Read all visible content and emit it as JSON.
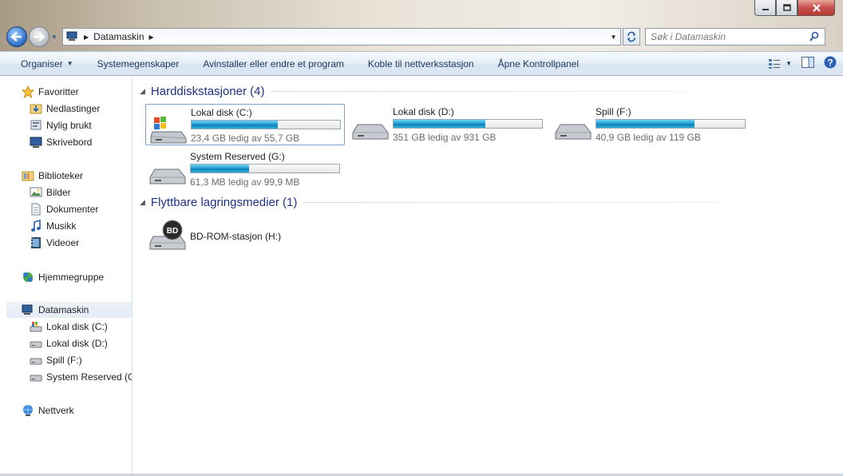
{
  "window": {
    "caption_buttons": [
      "minimize",
      "maximize",
      "close"
    ]
  },
  "address": {
    "crumbs": [
      "Datamaskin"
    ],
    "search_placeholder": "Søk i Datamaskin"
  },
  "toolbar": {
    "organize": "Organiser",
    "system_properties": "Systemegenskaper",
    "uninstall": "Avinstaller eller endre et program",
    "map_drive": "Koble til nettverksstasjon",
    "control_panel": "Åpne Kontrollpanel"
  },
  "nav": {
    "favorites": "Favoritter",
    "downloads": "Nedlastinger",
    "recent": "Nylig brukt",
    "desktop": "Skrivebord",
    "libraries": "Biblioteker",
    "pictures": "Bilder",
    "documents": "Dokumenter",
    "music": "Musikk",
    "videos": "Videoer",
    "homegroup": "Hjemmegruppe",
    "computer": "Datamaskin",
    "drive_c": "Lokal disk (C:)",
    "drive_d": "Lokal disk (D:)",
    "drive_f": "Spill (F:)",
    "drive_g": "System Reserved (G:)",
    "network": "Nettverk"
  },
  "groups": {
    "hdd": "Harddiskstasjoner (4)",
    "removable": "Flyttbare lagringsmedier (1)"
  },
  "drives": [
    {
      "name": "Lokal disk (C:)",
      "free": "23,4 GB ledig av 55,7 GB",
      "used_fraction": 0.58,
      "icon": "windows-drive-icon"
    },
    {
      "name": "Lokal disk (D:)",
      "free": "351 GB ledig av 931 GB",
      "used_fraction": 0.62,
      "icon": "hard-drive-icon"
    },
    {
      "name": "Spill (F:)",
      "free": "40,9 GB ledig av 119 GB",
      "used_fraction": 0.66,
      "icon": "hard-drive-icon"
    },
    {
      "name": "System Reserved (G:)",
      "free": "61,3 MB ledig av 99,9 MB",
      "used_fraction": 0.39,
      "icon": "hard-drive-icon"
    }
  ],
  "removable": [
    {
      "name": "BD-ROM-stasjon (H:)",
      "badge": "BD",
      "icon": "bd-rom-drive-icon"
    }
  ]
}
